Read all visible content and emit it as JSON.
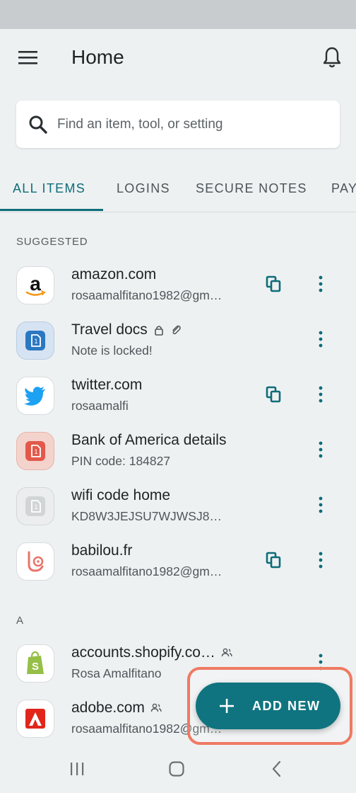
{
  "header": {
    "title": "Home",
    "menu_icon": "hamburger-menu-icon",
    "notification_icon": "bell-icon"
  },
  "search": {
    "placeholder": "Find an item, tool, or setting",
    "value": ""
  },
  "tabs": [
    {
      "label": "ALL ITEMS",
      "active": true
    },
    {
      "label": "LOGINS",
      "active": false
    },
    {
      "label": "SECURE NOTES",
      "active": false
    },
    {
      "label": "PAY",
      "active": false
    }
  ],
  "sections": {
    "suggested": "SUGGESTED",
    "a": "A"
  },
  "items": [
    {
      "title": "amazon.com",
      "subtitle": "rosaamalfitano1982@gm…",
      "icon": "amazon-logo-icon",
      "copy": true
    },
    {
      "title": "Travel docs",
      "subtitle": "Note is locked!",
      "icon": "secure-note-blue-icon",
      "locked": true,
      "attachment": true
    },
    {
      "title": "twitter.com",
      "subtitle": "rosaamalfi",
      "icon": "twitter-logo-icon",
      "copy": true
    },
    {
      "title": "Bank of America details",
      "subtitle": "PIN code: 184827",
      "icon": "secure-note-red-icon"
    },
    {
      "title": "wifi code home",
      "subtitle": "KD8W3JEJSU7WJWSJ8…",
      "icon": "secure-note-gray-icon"
    },
    {
      "title": "babilou.fr",
      "subtitle": "rosaamalfitano1982@gm…",
      "icon": "babilou-logo-icon",
      "copy": true
    },
    {
      "title": "accounts.shopify.co…",
      "subtitle": "Rosa Amalfitano",
      "icon": "shopify-logo-icon",
      "shared": true
    },
    {
      "title": "adobe.com",
      "subtitle": "rosaamalfitano1982@gm…",
      "icon": "adobe-logo-icon",
      "shared": true
    }
  ],
  "fab": {
    "label": "ADD NEW",
    "icon": "plus-icon"
  },
  "colors": {
    "accent": "#0d6d78",
    "fab": "#0f7480",
    "highlight": "#ef7a63",
    "background": "#eef1f2"
  }
}
